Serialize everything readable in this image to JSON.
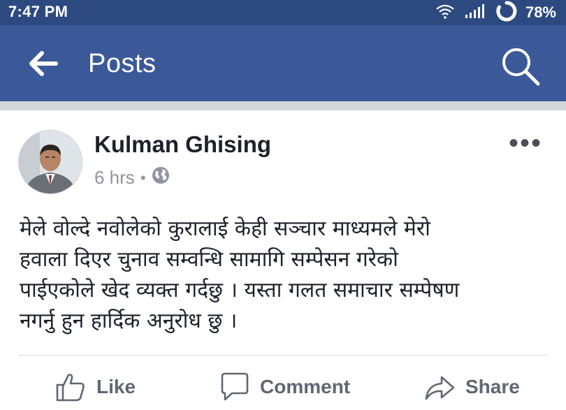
{
  "status_bar": {
    "time": "7:47 PM",
    "battery": "78%",
    "icons": [
      "wifi-icon",
      "signal-icon",
      "sync-icon"
    ]
  },
  "app_bar": {
    "title": "Posts",
    "icons": [
      "back-arrow-icon",
      "search-icon"
    ]
  },
  "post": {
    "author": "Kulman Ghising",
    "time": "6 hrs",
    "separator": "•",
    "privacy_icon": "globe-icon",
    "more": "•••",
    "body_lines": [
      "मेले वोल्दे नवोलेको कुरालाई केही सञ्चार माध्यमले मेरो",
      "हवाला दिएर चुनाव सम्वन्धि सामागि सम्पेसन गरेको",
      "पाईएकोले खेद व्यक्त गर्दछु । यस्ता गलत समाचार सम्पेषण",
      "नगर्नु हुन हार्दिक अनुरोध छु ।"
    ]
  },
  "actions": {
    "like": "Like",
    "comment": "Comment",
    "share": "Share"
  },
  "colors": {
    "status_bar": "#2d4a80",
    "app_bar": "#3b5998",
    "action_text": "#606770",
    "meta_text": "#90949c"
  }
}
